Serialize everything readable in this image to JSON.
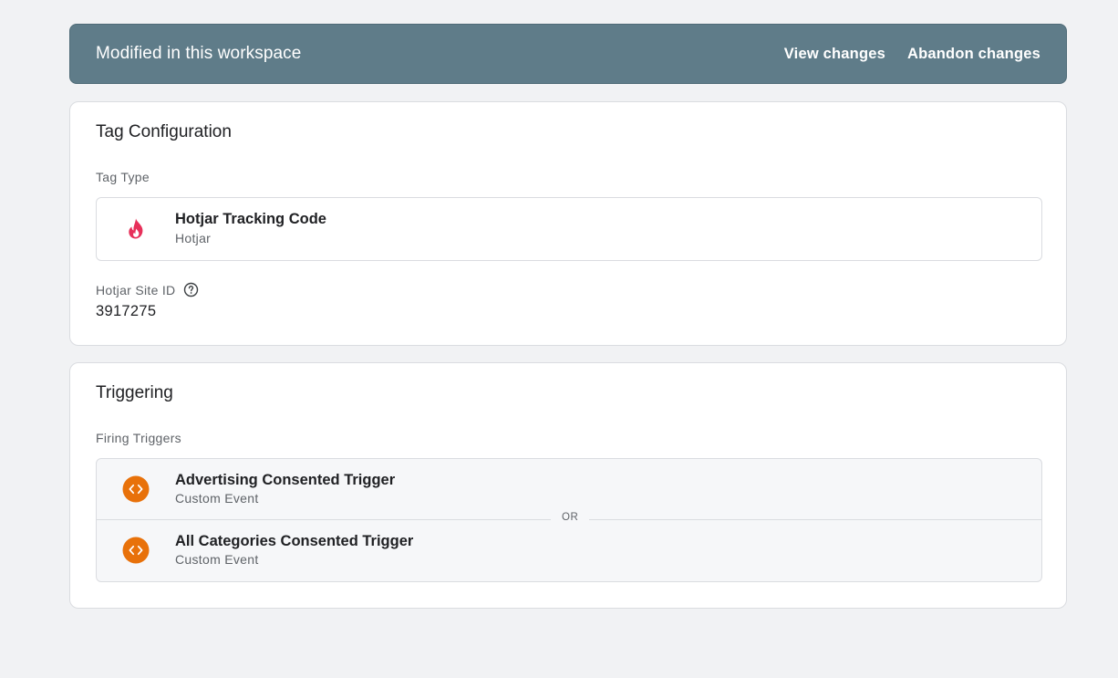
{
  "banner": {
    "title": "Modified in this workspace",
    "view_changes": "View changes",
    "abandon_changes": "Abandon changes"
  },
  "tag_configuration": {
    "title": "Tag Configuration",
    "tag_type_label": "Tag Type",
    "tag_type": {
      "name": "Hotjar Tracking Code",
      "vendor": "Hotjar",
      "icon": "hotjar-flame-icon"
    },
    "site_id_label": "Hotjar Site ID",
    "site_id_value": "3917275"
  },
  "triggering": {
    "title": "Triggering",
    "firing_triggers_label": "Firing Triggers",
    "or_label": "OR",
    "triggers": [
      {
        "name": "Advertising Consented Trigger",
        "type": "Custom Event",
        "icon": "custom-event-code-icon"
      },
      {
        "name": "All Categories Consented Trigger",
        "type": "Custom Event",
        "icon": "custom-event-code-icon"
      }
    ]
  },
  "colors": {
    "banner_bg": "#5f7c89",
    "hotjar_flame": "#e7305a",
    "custom_event_orange": "#e8710a",
    "page_bg": "#f1f2f4"
  }
}
